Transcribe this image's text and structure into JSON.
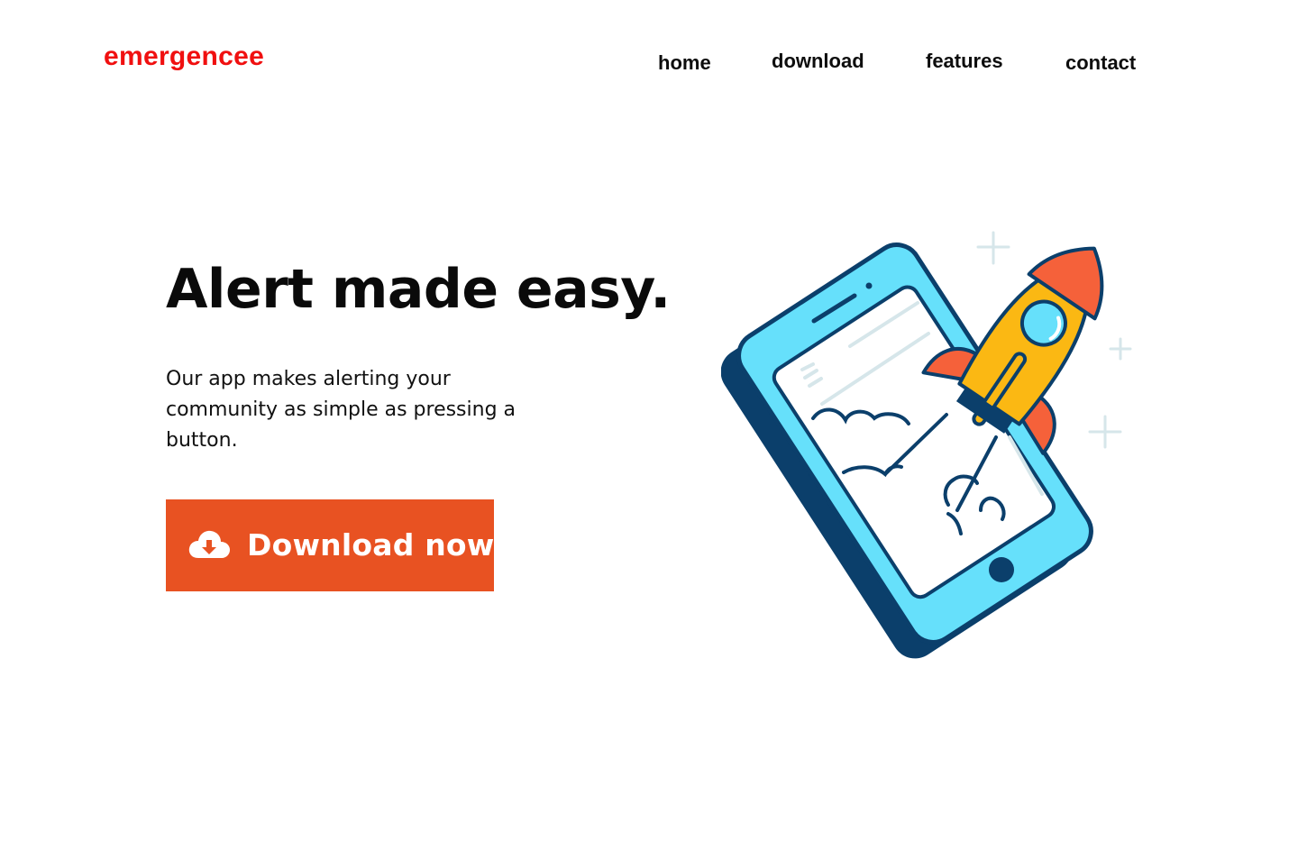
{
  "brand": {
    "name": "emergencee",
    "color": "#f01010"
  },
  "nav": {
    "items": [
      {
        "label": "home"
      },
      {
        "label": "download"
      },
      {
        "label": "features"
      },
      {
        "label": "contact"
      }
    ]
  },
  "hero": {
    "title": "Alert made easy.",
    "description": "Our app makes alerting your community as simple as pressing a button.",
    "cta_label": "Download now",
    "cta_color": "#e85222",
    "cta_icon": "cloud-download-icon"
  },
  "illustration": {
    "name": "phone-rocket-illustration",
    "colors": {
      "phone_body": "#66e0fb",
      "phone_shadow": "#0b3f6b",
      "rocket_body": "#fbb813",
      "rocket_fins": "#f5613a",
      "outline": "#0b3f6b"
    }
  }
}
